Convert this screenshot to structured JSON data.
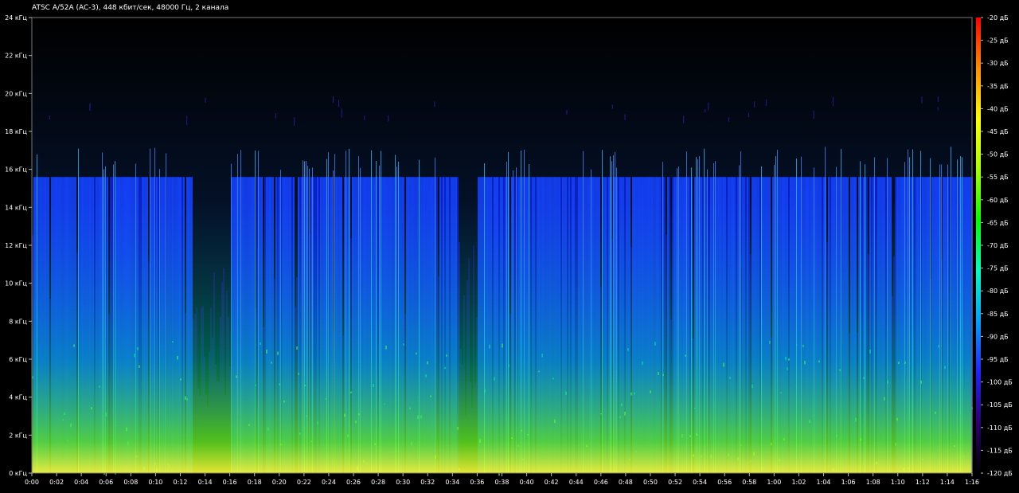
{
  "chart_data": {
    "type": "heatmap",
    "title": "ATSC A/52A (AC-3), 448 кбит/сек, 48000 Гц, 2 канала",
    "xlabel": "",
    "ylabel": "",
    "x_ticks": [
      "0:00",
      "0:02",
      "0:04",
      "0:06",
      "0:08",
      "0:10",
      "0:12",
      "0:14",
      "0:16",
      "0:18",
      "0:20",
      "0:22",
      "0:24",
      "0:26",
      "0:28",
      "0:30",
      "0:32",
      "0:34",
      "0:36",
      "0:38",
      "0:40",
      "0:42",
      "0:44",
      "0:46",
      "0:48",
      "0:50",
      "0:52",
      "0:54",
      "0:56",
      "0:58",
      "1:00",
      "1:02",
      "1:04",
      "1:06",
      "1:08",
      "1:10",
      "1:12",
      "1:14",
      "1:16"
    ],
    "x_range_seconds": [
      0,
      76
    ],
    "y_ticks": [
      "0 кГц",
      "2 кГц",
      "4 кГц",
      "6 кГц",
      "8 кГц",
      "10 кГц",
      "12 кГц",
      "14 кГц",
      "16 кГц",
      "18 кГц",
      "20 кГц",
      "22 кГц",
      "24 кГц"
    ],
    "y_range_khz": [
      0,
      24
    ],
    "colorbar_ticks": [
      "-20 дБ",
      "-25 дБ",
      "-30 дБ",
      "-35 дБ",
      "-40 дБ",
      "-45 дБ",
      "-50 дБ",
      "-55 дБ",
      "-60 дБ",
      "-65 дБ",
      "-70 дБ",
      "-75 дБ",
      "-80 дБ",
      "-85 дБ",
      "-90 дБ",
      "-95 дБ",
      "-100 дБ",
      "-105 дБ",
      "-110 дБ",
      "-115 дБ",
      "-120 дБ"
    ],
    "colorbar_range_db": [
      -120,
      -20
    ],
    "colorbar_stops": [
      "#000000",
      "#2a0070",
      "#2222ff",
      "#00a0ff",
      "#00ffc0",
      "#00ff00",
      "#aaff00",
      "#ffff00",
      "#ff8c00",
      "#ff0000"
    ],
    "cutoff_khz": 15.6,
    "quiet_segments_seconds": [
      [
        12.9,
        16.0
      ],
      [
        34.5,
        36.0
      ]
    ],
    "grid": false,
    "legend": "colorbar-right"
  }
}
